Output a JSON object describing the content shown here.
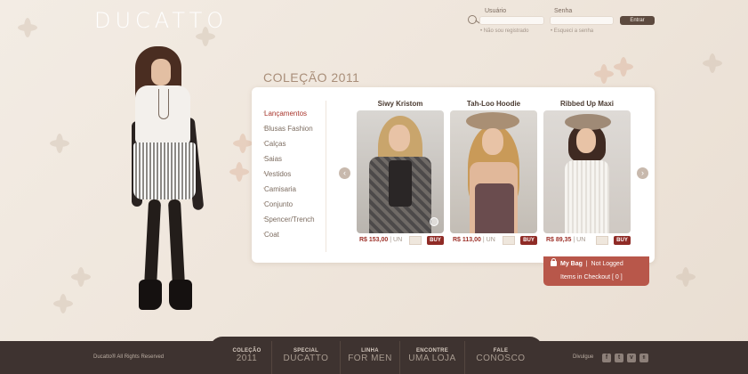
{
  "brand": {
    "logo": "DUCATTO"
  },
  "login": {
    "user_label": "Usuário",
    "password_label": "Senha",
    "submit_label": "Entrar",
    "not_registered": "Não sou registrado",
    "forgot_password": "Esqueci a senha"
  },
  "collection": {
    "title": "COLEÇÃO 2011"
  },
  "categories": [
    {
      "label": "Lançamentos",
      "active": true
    },
    {
      "label": "Blusas Fashion"
    },
    {
      "label": "Calças"
    },
    {
      "label": "Saias"
    },
    {
      "label": "Vestidos"
    },
    {
      "label": "Camisaria"
    },
    {
      "label": "Conjunto"
    },
    {
      "label": "Spencer/Trench"
    },
    {
      "label": "Coat"
    }
  ],
  "carousel": {
    "prev_glyph": "‹",
    "next_glyph": "›"
  },
  "products": [
    {
      "name": "Siwy Kristom",
      "price": "R$ 153,00",
      "unit": "| UN",
      "buy": "BUY"
    },
    {
      "name": "Tah-Loo Hoodie",
      "price": "R$ 113,00",
      "unit": "| UN",
      "buy": "BUY"
    },
    {
      "name": "Ribbed Up Maxi",
      "price": "R$ 89,35",
      "unit": "| UN",
      "buy": "BUY"
    }
  ],
  "bag": {
    "title": "My Bag",
    "status": "Not Logged",
    "checkout": "Items in Checkout [ 0 ]"
  },
  "footer": {
    "copyright": "Ducatto® All Rights Reserved",
    "nav": [
      {
        "top": "COLEÇÃO",
        "bottom": "2011"
      },
      {
        "top": "SPECIAL",
        "bottom": "DUCATTO"
      },
      {
        "top": "LINHA",
        "bottom": "FOR MEN"
      },
      {
        "top": "ENCONTRE",
        "bottom": "UMA LOJA"
      },
      {
        "top": "FALE",
        "bottom": "CONOSCO"
      }
    ],
    "share_label": "Divulgue",
    "social": [
      "f",
      "t",
      "v",
      "fl"
    ]
  },
  "colors": {
    "accent": "#8f2b26",
    "bag": "#b8574a",
    "footer": "#3e3330",
    "background": "#efe6dc"
  }
}
